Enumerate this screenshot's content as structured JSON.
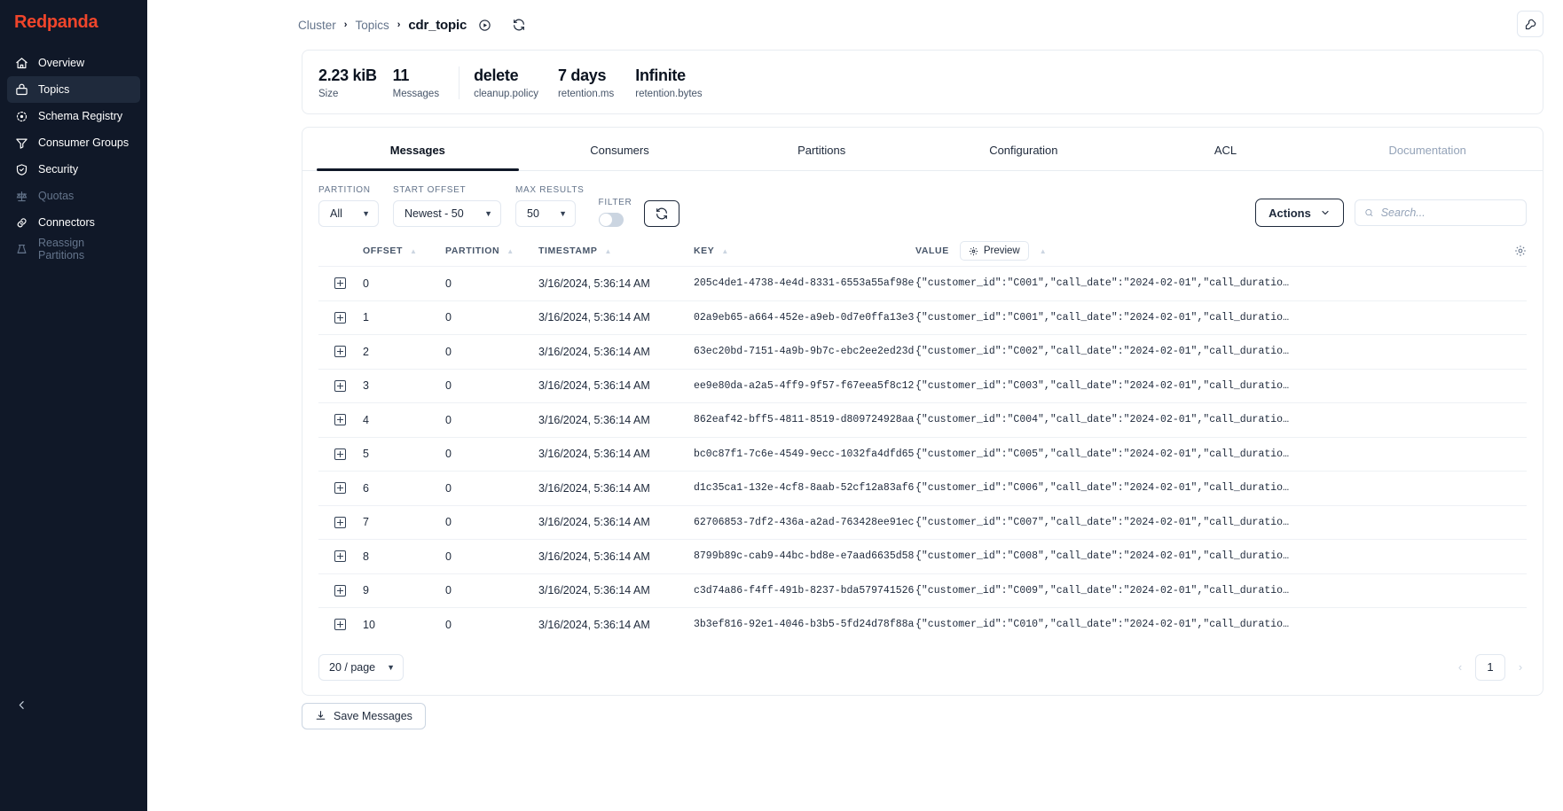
{
  "sidebar": {
    "brand": "Redpanda",
    "items": [
      {
        "label": "Overview",
        "icon": "home-icon",
        "state": "normal"
      },
      {
        "label": "Topics",
        "icon": "topics-icon",
        "state": "active"
      },
      {
        "label": "Schema Registry",
        "icon": "schema-registry-icon",
        "state": "normal"
      },
      {
        "label": "Consumer Groups",
        "icon": "funnel-icon",
        "state": "normal"
      },
      {
        "label": "Security",
        "icon": "shield-check-icon",
        "state": "normal"
      },
      {
        "label": "Quotas",
        "icon": "scales-icon",
        "state": "disabled"
      },
      {
        "label": "Connectors",
        "icon": "link-icon",
        "state": "normal"
      },
      {
        "label": "Reassign Partitions",
        "icon": "reassign-icon",
        "state": "disabled"
      }
    ]
  },
  "topbar": {
    "breadcrumb": [
      "Cluster",
      "Topics"
    ],
    "current": "cdr_topic",
    "separator": "›"
  },
  "stats": [
    {
      "value": "2.23 kiB",
      "label": "Size"
    },
    {
      "value": "11",
      "label": "Messages"
    },
    {
      "value": "delete",
      "label": "cleanup.policy"
    },
    {
      "value": "7 days",
      "label": "retention.ms"
    },
    {
      "value": "Infinite",
      "label": "retention.bytes"
    }
  ],
  "tabs": [
    {
      "label": "Messages",
      "state": "active"
    },
    {
      "label": "Consumers",
      "state": "normal"
    },
    {
      "label": "Partitions",
      "state": "normal"
    },
    {
      "label": "Configuration",
      "state": "normal"
    },
    {
      "label": "ACL",
      "state": "normal"
    },
    {
      "label": "Documentation",
      "state": "disabled"
    }
  ],
  "controls": {
    "partition_label": "PARTITION",
    "partition_value": "All",
    "start_offset_label": "START OFFSET",
    "start_offset_value": "Newest - 50",
    "max_results_label": "MAX RESULTS",
    "max_results_value": "50",
    "filter_label": "FILTER",
    "filter_on": false,
    "actions_label": "Actions",
    "search_placeholder": "Search..."
  },
  "table": {
    "columns": {
      "offset": "OFFSET",
      "partition": "PARTITION",
      "timestamp": "TIMESTAMP",
      "key": "KEY",
      "value": "VALUE"
    },
    "preview_label": "Preview",
    "rows": [
      {
        "offset": "0",
        "partition": "0",
        "timestamp": "3/16/2024, 5:36:14 AM",
        "key": "205c4de1-4738-4e4d-8331-6553a55af98e",
        "value": "{\"customer_id\":\"C001\",\"call_date\":\"2024-02-01\",\"call_duratio…"
      },
      {
        "offset": "1",
        "partition": "0",
        "timestamp": "3/16/2024, 5:36:14 AM",
        "key": "02a9eb65-a664-452e-a9eb-0d7e0ffa13e3",
        "value": "{\"customer_id\":\"C001\",\"call_date\":\"2024-02-01\",\"call_duratio…"
      },
      {
        "offset": "2",
        "partition": "0",
        "timestamp": "3/16/2024, 5:36:14 AM",
        "key": "63ec20bd-7151-4a9b-9b7c-ebc2ee2ed23d",
        "value": "{\"customer_id\":\"C002\",\"call_date\":\"2024-02-01\",\"call_duratio…"
      },
      {
        "offset": "3",
        "partition": "0",
        "timestamp": "3/16/2024, 5:36:14 AM",
        "key": "ee9e80da-a2a5-4ff9-9f57-f67eea5f8c12",
        "value": "{\"customer_id\":\"C003\",\"call_date\":\"2024-02-01\",\"call_duratio…"
      },
      {
        "offset": "4",
        "partition": "0",
        "timestamp": "3/16/2024, 5:36:14 AM",
        "key": "862eaf42-bff5-4811-8519-d809724928aa",
        "value": "{\"customer_id\":\"C004\",\"call_date\":\"2024-02-01\",\"call_duratio…"
      },
      {
        "offset": "5",
        "partition": "0",
        "timestamp": "3/16/2024, 5:36:14 AM",
        "key": "bc0c87f1-7c6e-4549-9ecc-1032fa4dfd65",
        "value": "{\"customer_id\":\"C005\",\"call_date\":\"2024-02-01\",\"call_duratio…"
      },
      {
        "offset": "6",
        "partition": "0",
        "timestamp": "3/16/2024, 5:36:14 AM",
        "key": "d1c35ca1-132e-4cf8-8aab-52cf12a83af6",
        "value": "{\"customer_id\":\"C006\",\"call_date\":\"2024-02-01\",\"call_duratio…"
      },
      {
        "offset": "7",
        "partition": "0",
        "timestamp": "3/16/2024, 5:36:14 AM",
        "key": "62706853-7df2-436a-a2ad-763428ee91ec",
        "value": "{\"customer_id\":\"C007\",\"call_date\":\"2024-02-01\",\"call_duratio…"
      },
      {
        "offset": "8",
        "partition": "0",
        "timestamp": "3/16/2024, 5:36:14 AM",
        "key": "8799b89c-cab9-44bc-bd8e-e7aad6635d58",
        "value": "{\"customer_id\":\"C008\",\"call_date\":\"2024-02-01\",\"call_duratio…"
      },
      {
        "offset": "9",
        "partition": "0",
        "timestamp": "3/16/2024, 5:36:14 AM",
        "key": "c3d74a86-f4ff-491b-8237-bda579741526",
        "value": "{\"customer_id\":\"C009\",\"call_date\":\"2024-02-01\",\"call_duratio…"
      },
      {
        "offset": "10",
        "partition": "0",
        "timestamp": "3/16/2024, 5:36:14 AM",
        "key": "3b3ef816-92e1-4046-b3b5-5fd24d78f88a",
        "value": "{\"customer_id\":\"C010\",\"call_date\":\"2024-02-01\",\"call_duratio…"
      }
    ]
  },
  "footer": {
    "page_size": "20 / page",
    "current_page": "1",
    "prev": "‹",
    "next": "›",
    "save_messages": "Save Messages"
  },
  "colors": {
    "brand": "#f0452b",
    "sidebar_bg": "#101828",
    "sidebar_active": "#1f2a3c",
    "text_dark": "#0b1320",
    "muted": "#64748b",
    "border": "#e8ecf1"
  }
}
